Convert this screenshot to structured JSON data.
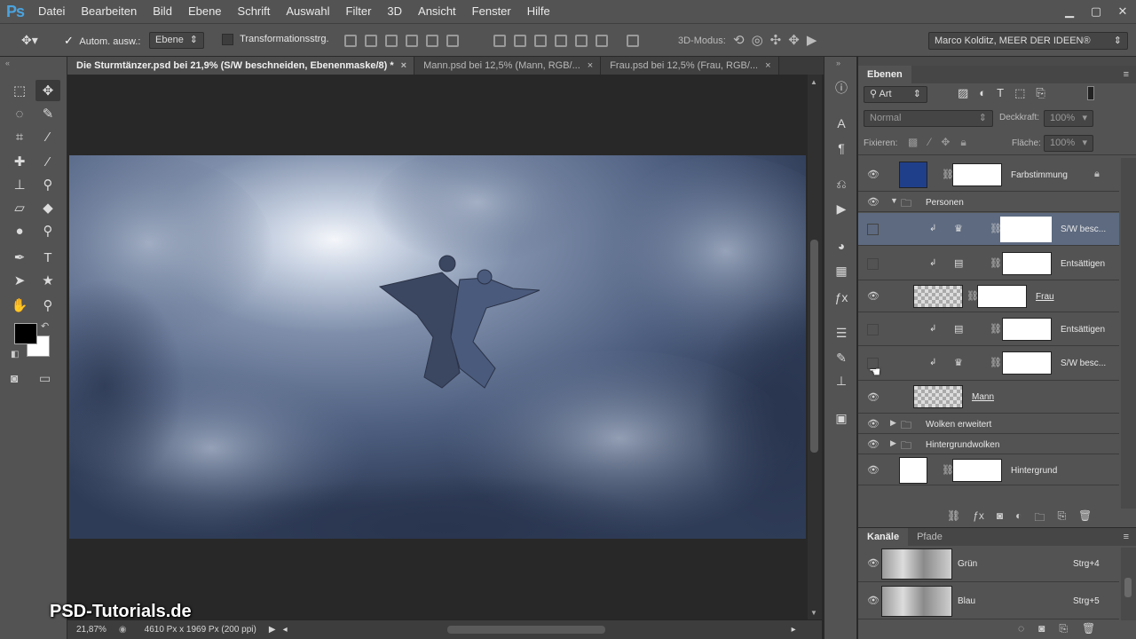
{
  "app": {
    "logo": "Ps"
  },
  "menubar": {
    "items": [
      "Datei",
      "Bearbeiten",
      "Bild",
      "Ebene",
      "Schrift",
      "Auswahl",
      "Filter",
      "3D",
      "Ansicht",
      "Fenster",
      "Hilfe"
    ]
  },
  "options": {
    "auto_select_label": "Autom. ausw.:",
    "auto_select_value": "Ebene",
    "transform_label": "Transformationsstrg.",
    "mode3d_label": "3D-Modus:",
    "workspace": "Marco Kolditz, MEER DER IDEEN®"
  },
  "tabs": [
    {
      "label": "Die Sturmtänzer.psd bei 21,9% (S/W beschneiden, Ebenenmaske/8) *",
      "close": "×"
    },
    {
      "label": "Mann.psd bei 12,5% (Mann, RGB/...",
      "close": "×"
    },
    {
      "label": "Frau.psd bei 12,5% (Frau, RGB/...",
      "close": "×"
    }
  ],
  "status": {
    "zoom": "21,87%",
    "doc_size": "4610 Px x 1969 Px (200 ppi)"
  },
  "watermark": "PSD-Tutorials.de",
  "layers_panel": {
    "tab": "Ebenen",
    "filter": "Art",
    "blend_mode": "Normal",
    "opacity_label": "Deckkraft:",
    "opacity_value": "100%",
    "lock_label": "Fixieren:",
    "fill_label": "Fläche:",
    "fill_value": "100%",
    "layers": [
      {
        "name": "Farbstimmung"
      },
      {
        "name": "Personen"
      },
      {
        "name": "S/W besc..."
      },
      {
        "name": "Entsättigen"
      },
      {
        "name": "Frau"
      },
      {
        "name": "Entsättigen"
      },
      {
        "name": "S/W besc..."
      },
      {
        "name": "Mann"
      },
      {
        "name": "Wolken erweitert"
      },
      {
        "name": "Hintergrundwolken"
      },
      {
        "name": "Hintergrund"
      }
    ]
  },
  "channels_panel": {
    "tabs": [
      "Kanäle",
      "Pfade"
    ],
    "channels": [
      {
        "name": "Grün",
        "shortcut": "Strg+4"
      },
      {
        "name": "Blau",
        "shortcut": "Strg+5"
      }
    ]
  },
  "colors": {
    "foreground": "#000000",
    "background": "#ffffff",
    "farbstimmung_fill": "#1f3f8a",
    "selected_layer": "#5d6a80"
  }
}
